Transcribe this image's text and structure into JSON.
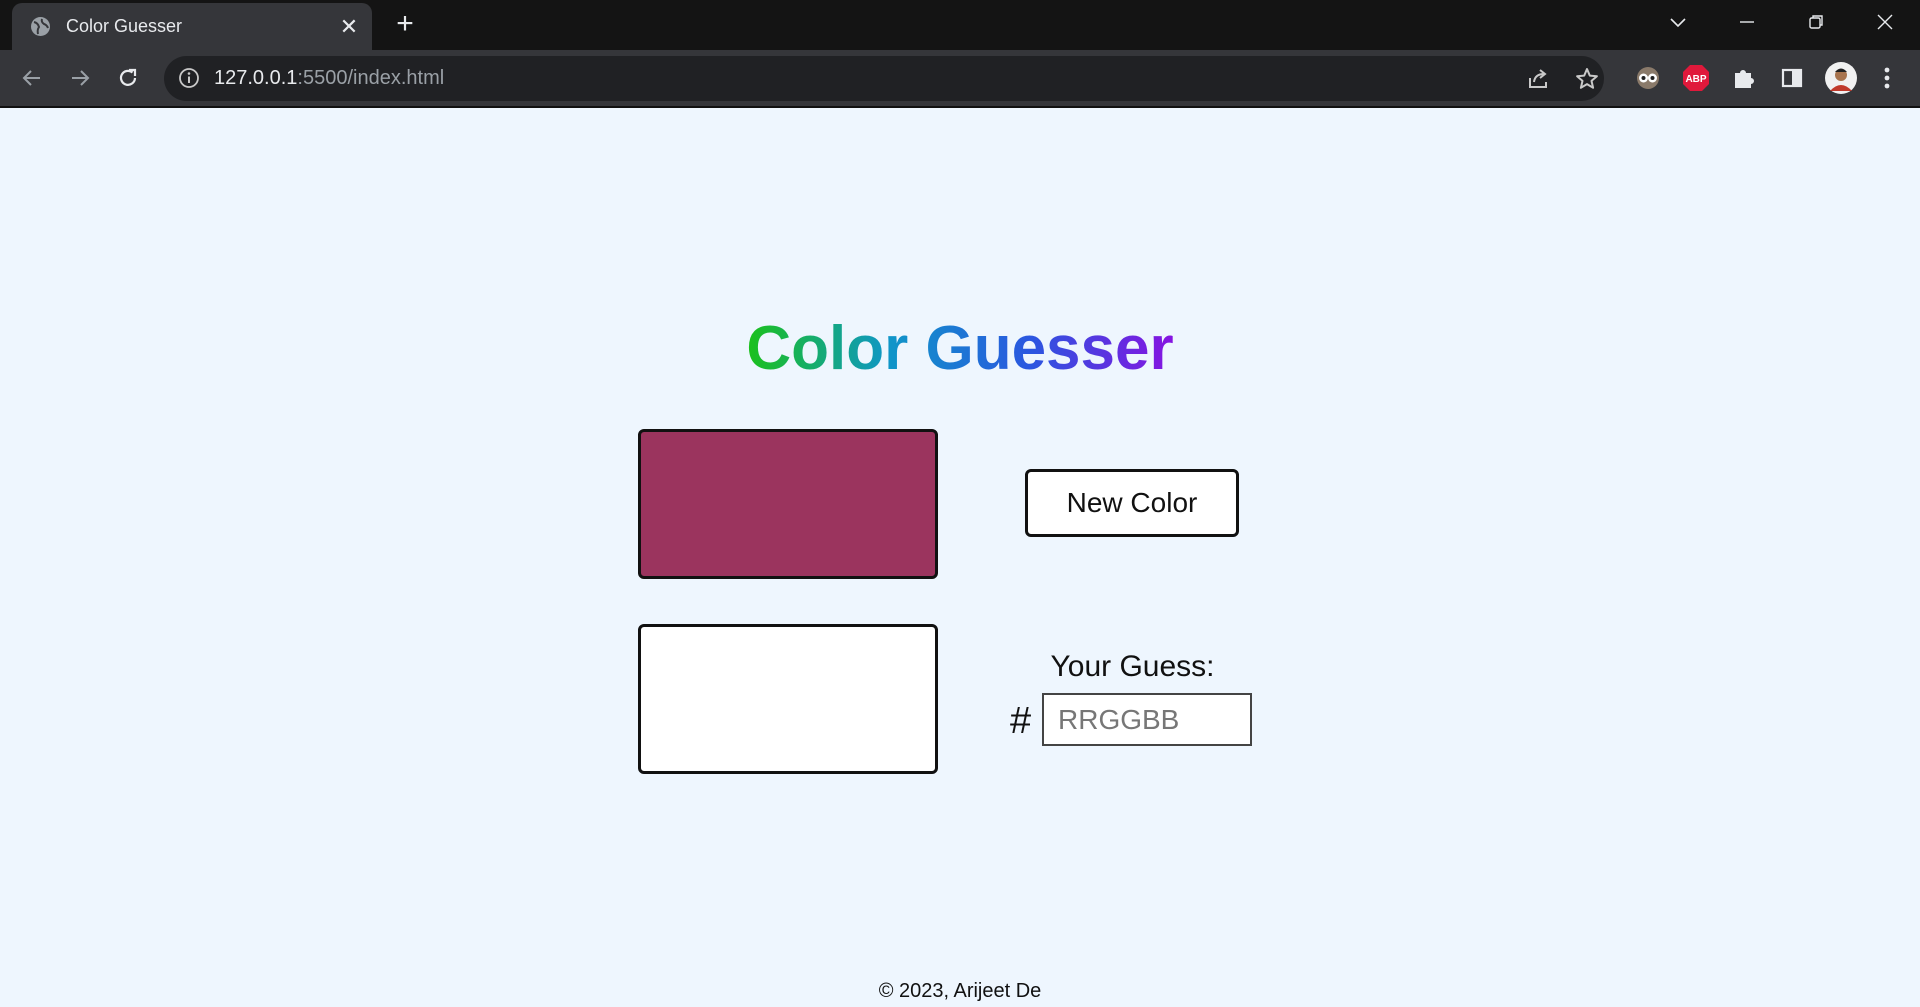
{
  "browser": {
    "tab_title": "Color Guesser",
    "url_host": "127.0.0.1",
    "url_rest": ":5500/index.html",
    "ext_abp_label": "ABP"
  },
  "page": {
    "title": "Color Guesser",
    "new_color_label": "New Color",
    "guess_label": "Your Guess:",
    "hash_symbol": "#",
    "guess_placeholder": "RRGGBB",
    "guess_value": "",
    "footer": "© 2023, Arijeet De"
  },
  "colors": {
    "target_swatch": "#9b345e",
    "guess_swatch": "#ffffff",
    "page_background": "#eef6fe",
    "title_gradient": [
      "#1cc11a",
      "#0f96c8",
      "#2b56e0",
      "#8713e1"
    ]
  },
  "icons": {
    "tab_favicon": "globe-icon",
    "tab_close": "close-icon",
    "new_tab": "plus-icon",
    "back": "arrow-left-icon",
    "forward": "arrow-right-icon",
    "reload": "reload-icon",
    "site_info": "info-icon",
    "share": "share-icon",
    "bookmark": "star-icon",
    "extensions": "puzzle-icon",
    "side_panel": "side-panel-icon",
    "menu": "kebab-menu-icon"
  }
}
